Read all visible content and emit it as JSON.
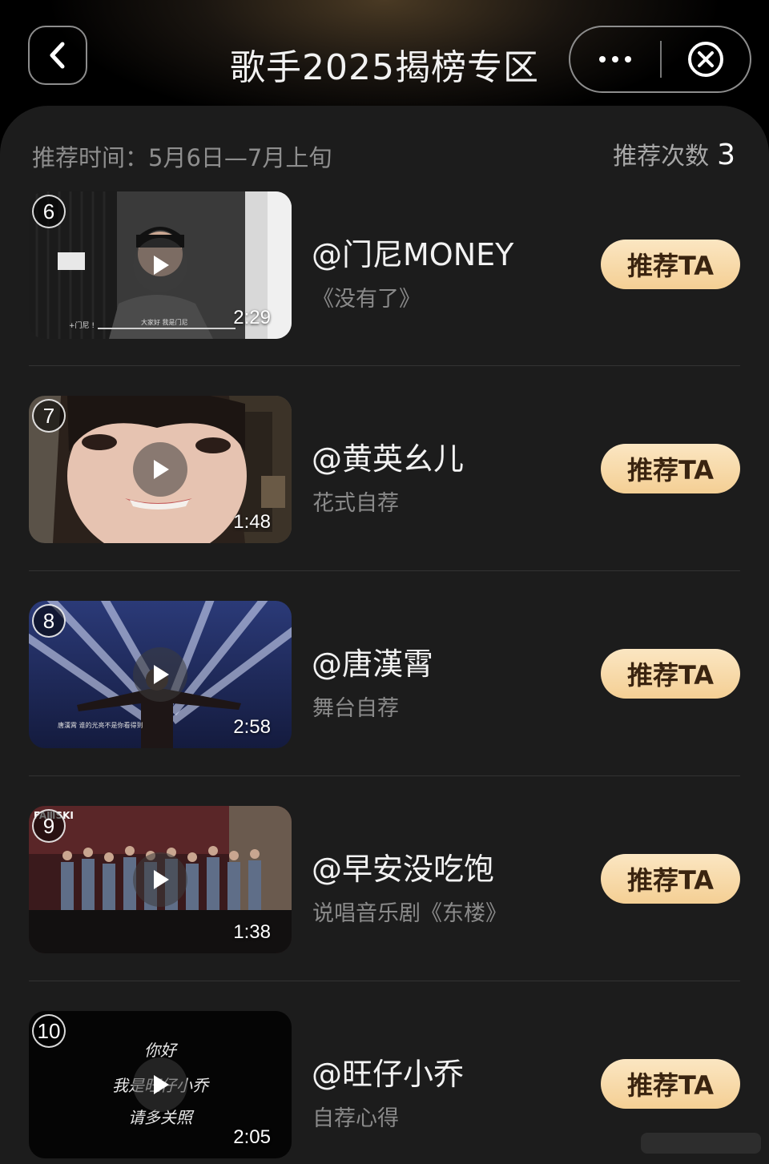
{
  "header": {
    "title": "歌手2025揭榜专区"
  },
  "meta": {
    "time_label": "推荐时间：5月6日—7月上旬",
    "count_label": "推荐次数",
    "count_value": "3"
  },
  "items": [
    {
      "rank": "6",
      "duration": "2:29",
      "name": "@门尼MONEY",
      "desc": "《没有了》",
      "button": "推荐TA",
      "thumb_caption": "大家好 我是门尼",
      "thumb_tag": "+门尼 !"
    },
    {
      "rank": "7",
      "duration": "1:48",
      "name": "@黄英幺儿",
      "desc": "花式自荐",
      "button": "推荐TA"
    },
    {
      "rank": "8",
      "duration": "2:58",
      "name": "@唐漢霄",
      "desc": "舞台自荐",
      "button": "推荐TA",
      "thumb_caption": "唐漢霄  谁的光亮不是你看得到"
    },
    {
      "rank": "9",
      "duration": "1:38",
      "name": "@早安没吃饱",
      "desc": "说唱音乐剧《东楼》",
      "button": "推荐TA",
      "thumb_logo": "FAⅢSKI"
    },
    {
      "rank": "10",
      "duration": "2:05",
      "name": "@旺仔小乔",
      "desc": "自荐心得",
      "button": "推荐TA",
      "thumb_lines": [
        "你好",
        "我是旺仔小乔",
        "请多关照"
      ]
    }
  ],
  "colors": {
    "button_bg": "#f4cf94",
    "button_text": "#3a2410",
    "panel_bg": "#1c1c1c",
    "muted_text": "#8a8a8a"
  }
}
